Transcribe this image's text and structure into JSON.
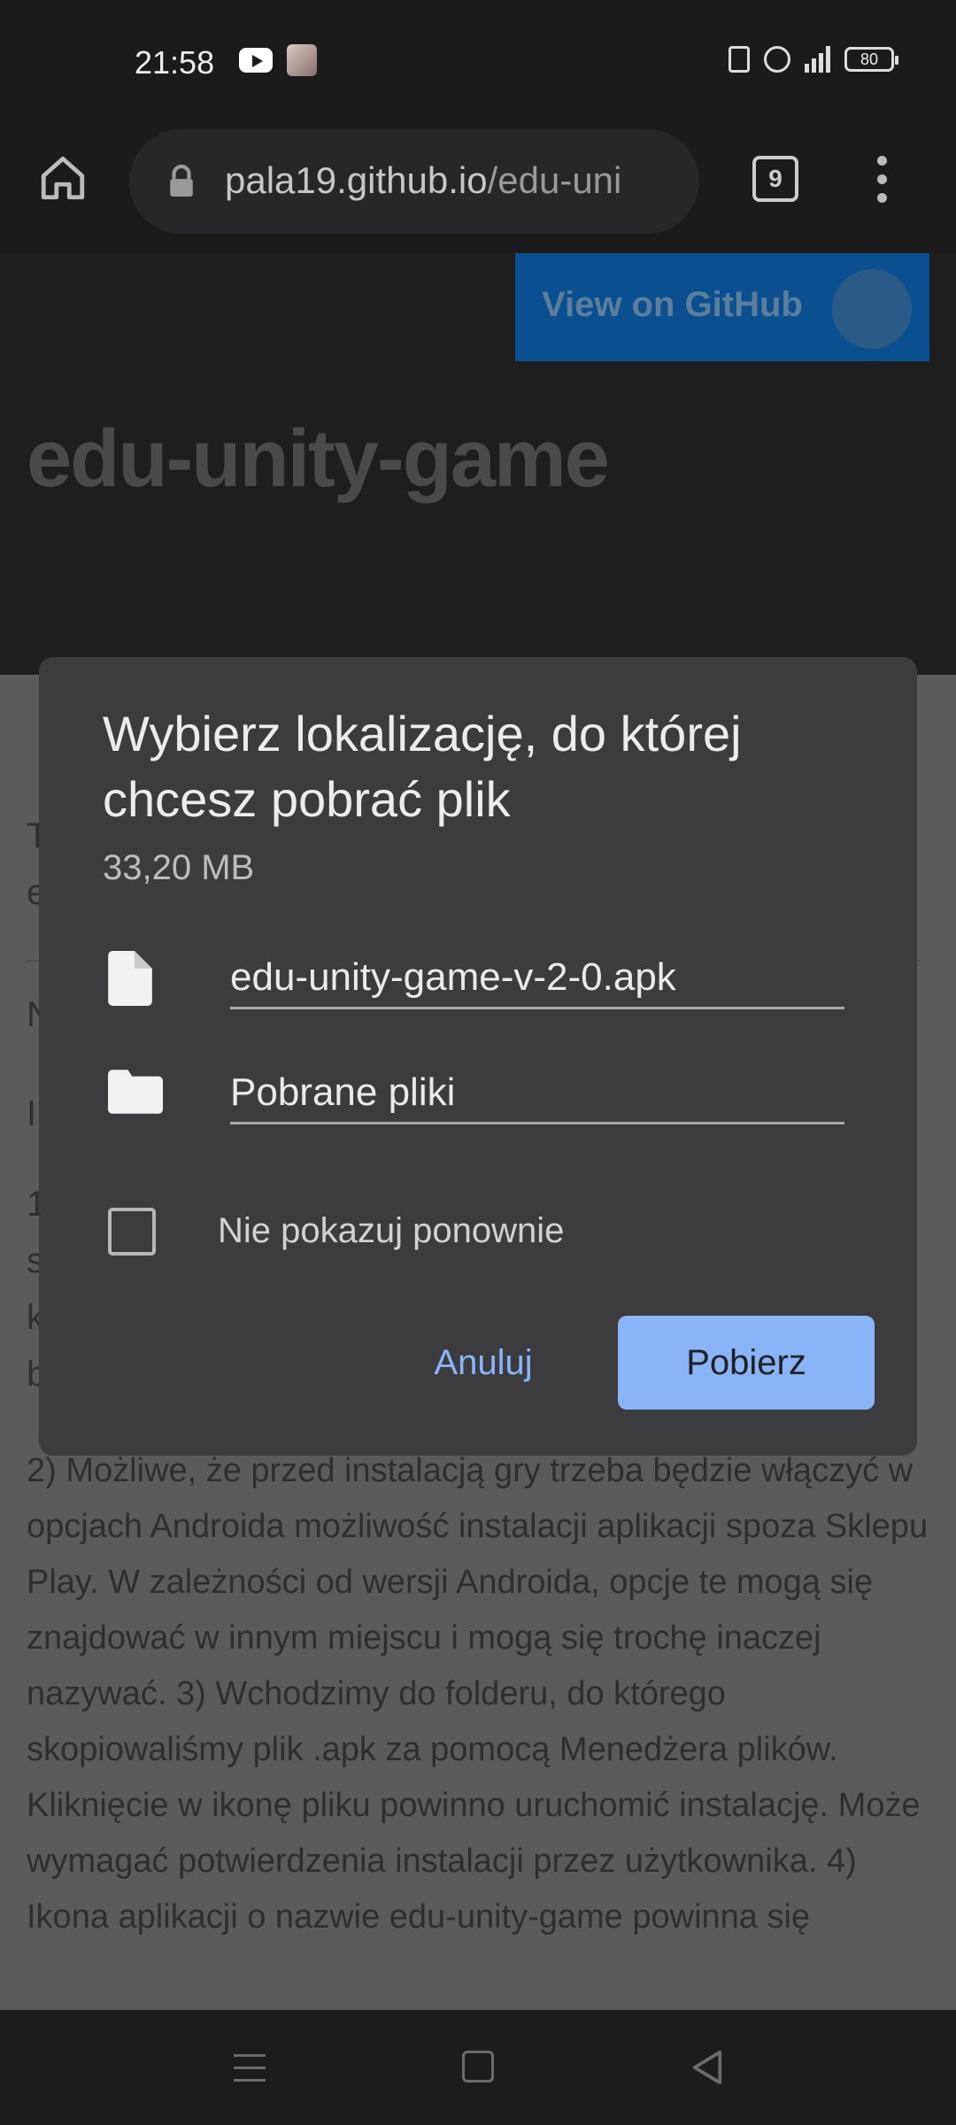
{
  "status_bar": {
    "time": "21:58",
    "battery": "80",
    "icons": [
      "youtube-icon",
      "avatar-icon",
      "nfc-icon",
      "alarm-icon",
      "signal-icon",
      "battery-icon"
    ]
  },
  "toolbar": {
    "url_host": "pala19.github.io",
    "url_path": "/edu-uni",
    "tab_count": "9"
  },
  "page": {
    "github_button": "View on GitHub",
    "title": "edu-unity-game",
    "stub_lines": [
      "T",
      "e",
      "N",
      "I",
      "1",
      "s",
      "k",
      "b"
    ],
    "body_text": "2) Możliwe, że przed instalacją gry trzeba będzie włączyć w opcjach Androida możliwość instalacji aplikacji spoza Sklepu Play. W zależności od wersji Androida, opcje te mogą się znajdować w innym miejscu i mogą się trochę inaczej nazywać. 3) Wchodzimy do folderu, do którego skopiowaliśmy plik .apk za pomocą Menedżera plików. Kliknięcie w ikonę pliku powinno uruchomić instalację. Może wymagać potwierdzenia instalacji przez użytkownika. 4) Ikona aplikacji o nazwie edu-unity-game powinna się"
  },
  "dialog": {
    "title": "Wybierz lokalizację, do której chcesz pobrać plik",
    "size": "33,20 MB",
    "filename": "edu-unity-game-v-2-0.apk",
    "folder": "Pobrane pliki",
    "checkbox_label": "Nie pokazuj ponownie",
    "cancel_label": "Anuluj",
    "download_label": "Pobierz"
  },
  "colors": {
    "accent": "#8ab4f8",
    "dialog_bg": "#3c3c3f",
    "github_button": "#0a4f8f"
  }
}
